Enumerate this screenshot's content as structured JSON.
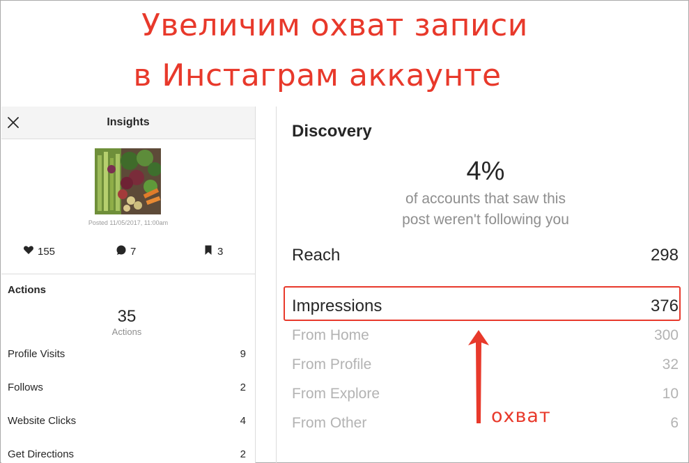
{
  "headline": {
    "line1": "Увеличим охват записи",
    "line2": "в Инстаграм аккаунте"
  },
  "left_panel": {
    "title": "Insights",
    "close_icon": "close-icon",
    "posted": "Posted 11/05/2017, 11:00am",
    "counts": {
      "likes": "155",
      "comments": "7",
      "saves": "3"
    },
    "actions": {
      "title": "Actions",
      "total": "35",
      "total_label": "Actions",
      "rows": [
        {
          "label": "Profile Visits",
          "value": "9"
        },
        {
          "label": "Follows",
          "value": "2"
        },
        {
          "label": "Website Clicks",
          "value": "4"
        },
        {
          "label": "Get Directions",
          "value": "2"
        }
      ]
    }
  },
  "right_panel": {
    "title": "Discovery",
    "percent": "4%",
    "percent_line1": "of accounts that saw this",
    "percent_line2": "post weren't following you",
    "reach": {
      "label": "Reach",
      "value": "298"
    },
    "impressions": {
      "label": "Impressions",
      "value": "376"
    },
    "sub_rows": [
      {
        "label": "From Home",
        "value": "300"
      },
      {
        "label": "From Profile",
        "value": "32"
      },
      {
        "label": "From Explore",
        "value": "10"
      },
      {
        "label": "From Other",
        "value": "6"
      }
    ]
  },
  "annotation": {
    "label": "охват",
    "color": "#e8392b"
  }
}
